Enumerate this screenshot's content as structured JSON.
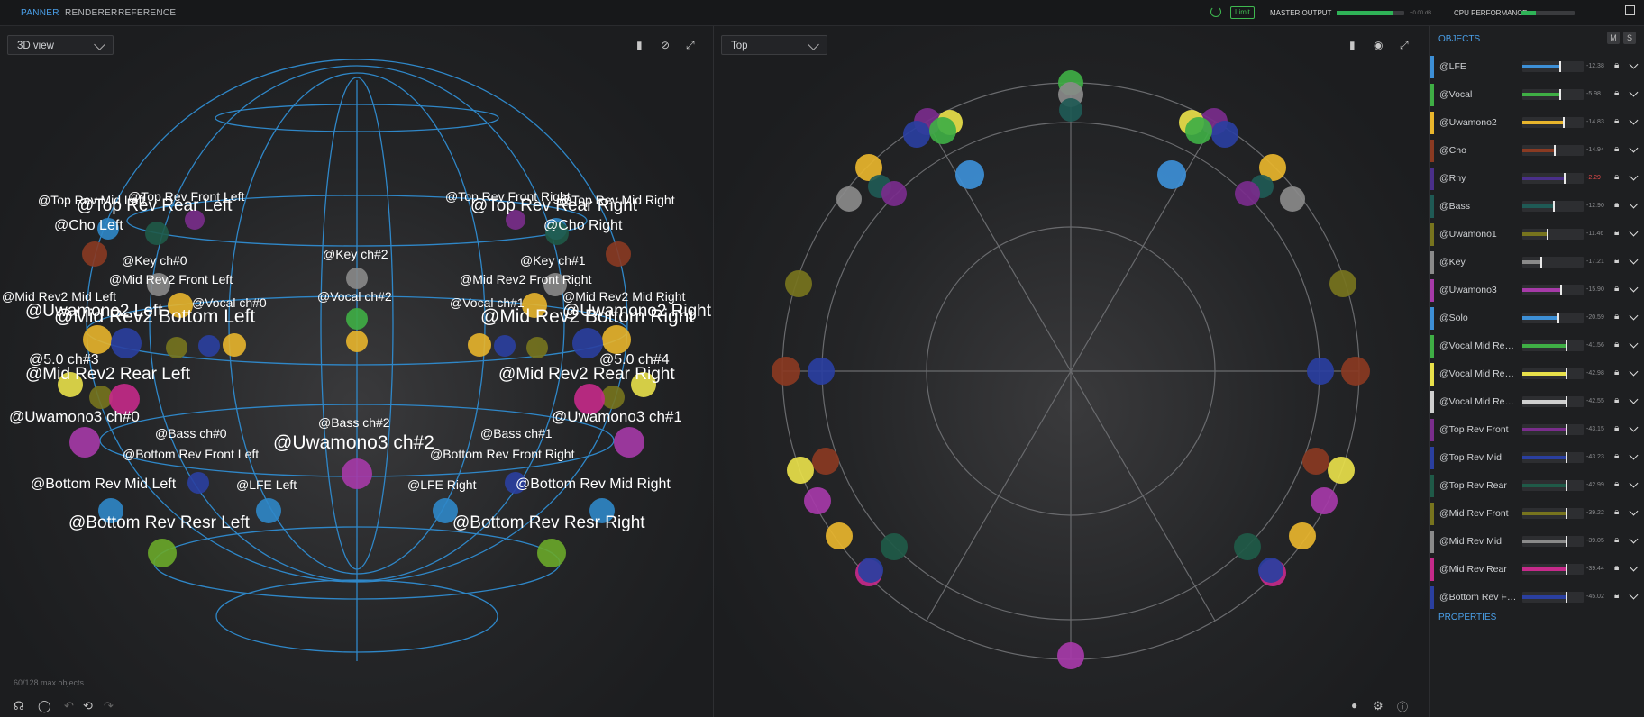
{
  "topbar": {
    "tabs": [
      {
        "label": "PANNER",
        "active": true
      },
      {
        "label": "RENDERER",
        "active": false
      },
      {
        "label": "REFERENCE",
        "active": false
      }
    ],
    "limit_label": "Limit",
    "master_output_label": "MASTER OUTPUT",
    "master_output_level": 0.82,
    "master_output_db": "+0.00 dB",
    "cpu_label": "CPU PERFORMANCE",
    "cpu_level": 0.28,
    "accent_color": "#4a9fe8",
    "meter_color": "#2fb357"
  },
  "left_view": {
    "view_select": "3D view",
    "max_objects": "60/128 max objects",
    "labels": [
      {
        "text": "@Top Rev Mid Left"
      },
      {
        "text": "@Top Rev Rear Left"
      },
      {
        "text": "@Top Rev Front Left"
      },
      {
        "text": "@Cho Left"
      },
      {
        "text": "@Top Rev Front Right"
      },
      {
        "text": "@Top Rev Rear Right"
      },
      {
        "text": "@Top Rev Mid Right"
      },
      {
        "text": "@Cho Right"
      },
      {
        "text": "@Key ch#0"
      },
      {
        "text": "@Key ch#2"
      },
      {
        "text": "@Key ch#1"
      },
      {
        "text": "@Mid Rev2 Front Left"
      },
      {
        "text": "@Mid Rev2 Front Right"
      },
      {
        "text": "@Mid Rev2 Mid Left"
      },
      {
        "text": "@Mid Rev2 Mid Right"
      },
      {
        "text": "@Vocal ch#0"
      },
      {
        "text": "@Vocal ch#2"
      },
      {
        "text": "@Vocal ch#1"
      },
      {
        "text": "@Uwamono2 Left"
      },
      {
        "text": "@Uwamono2 Right"
      },
      {
        "text": "@Mid Rev2 Bottom Left"
      },
      {
        "text": "@Mid Rev2 Bottom Right"
      },
      {
        "text": "@5.0 ch#3"
      },
      {
        "text": "@5.0 ch#4"
      },
      {
        "text": "@Mid Rev2 Rear Left"
      },
      {
        "text": "@Mid Rev2 Rear Right"
      },
      {
        "text": "@Uwamono3 ch#0"
      },
      {
        "text": "@Uwamono3 ch#1"
      },
      {
        "text": "@Uwamono3 ch#2"
      },
      {
        "text": "@Bass ch#0"
      },
      {
        "text": "@Bass ch#2"
      },
      {
        "text": "@Bass ch#1"
      },
      {
        "text": "@Bottom Rev Front Left"
      },
      {
        "text": "@Bottom Rev Front Right"
      },
      {
        "text": "@Bottom Rev Mid Left"
      },
      {
        "text": "@Bottom Rev Mid Right"
      },
      {
        "text": "@LFE Left"
      },
      {
        "text": "@LFE Right"
      },
      {
        "text": "@Bottom Rev Resr Left"
      },
      {
        "text": "@Bottom Rev Resr Right"
      }
    ]
  },
  "right_view": {
    "view_select": "Top"
  },
  "objects_panel": {
    "title": "OBJECTS",
    "mute_label": "M",
    "solo_label": "S",
    "properties_label": "PROPERTIES",
    "items": [
      {
        "name": "@LFE",
        "color": "#3d8fd6",
        "level": 0.6,
        "db": "-12.38"
      },
      {
        "name": "@Vocal",
        "color": "#3fae45",
        "level": 0.6,
        "db": "-5.98"
      },
      {
        "name": "@Uwamono2",
        "color": "#e8b52c",
        "level": 0.66,
        "db": "-14.83"
      },
      {
        "name": "@Cho",
        "color": "#8a3a22",
        "level": 0.52,
        "db": "-14.94"
      },
      {
        "name": "@Rhy",
        "color": "#4a2f8a",
        "level": 0.68,
        "db": "-2.29",
        "db_color": "#e24a4a"
      },
      {
        "name": "@Bass",
        "color": "#1f5a55",
        "level": 0.5,
        "db": "-12.90"
      },
      {
        "name": "@Uwamono1",
        "color": "#77741e",
        "level": 0.4,
        "db": "-11.46"
      },
      {
        "name": "@Key",
        "color": "#8a8a8a",
        "level": 0.3,
        "db": "-17.21"
      },
      {
        "name": "@Uwamono3",
        "color": "#a63aa8",
        "level": 0.62,
        "db": "-15.90"
      },
      {
        "name": "@Solo",
        "color": "#3d8fd6",
        "level": 0.58,
        "db": "-20.59"
      },
      {
        "name": "@Vocal Mid Rev…",
        "color": "#3fae45",
        "level": 0.7,
        "db": "-41.56"
      },
      {
        "name": "@Vocal Mid Rev…",
        "color": "#e8e04a",
        "level": 0.7,
        "db": "-42.98"
      },
      {
        "name": "@Vocal Mid Rev…",
        "color": "#cfcfcf",
        "level": 0.7,
        "db": "-42.55"
      },
      {
        "name": "@Top Rev Front",
        "color": "#7a2d8c",
        "level": 0.7,
        "db": "-43.15"
      },
      {
        "name": "@Top Rev Mid",
        "color": "#2a3fa0",
        "level": 0.7,
        "db": "-43.23"
      },
      {
        "name": "@Top Rev Rear",
        "color": "#1f5a48",
        "level": 0.7,
        "db": "-42.99"
      },
      {
        "name": "@Mid Rev Front",
        "color": "#77741e",
        "level": 0.7,
        "db": "-39.22"
      },
      {
        "name": "@Mid Rev Mid",
        "color": "#8a8a8a",
        "level": 0.7,
        "db": "-39.05"
      },
      {
        "name": "@Mid Rev Rear",
        "color": "#c52a8a",
        "level": 0.7,
        "db": "-39.44"
      },
      {
        "name": "@Bottom Rev F…",
        "color": "#2a3fa0",
        "level": 0.7,
        "db": "-45.02"
      }
    ]
  }
}
